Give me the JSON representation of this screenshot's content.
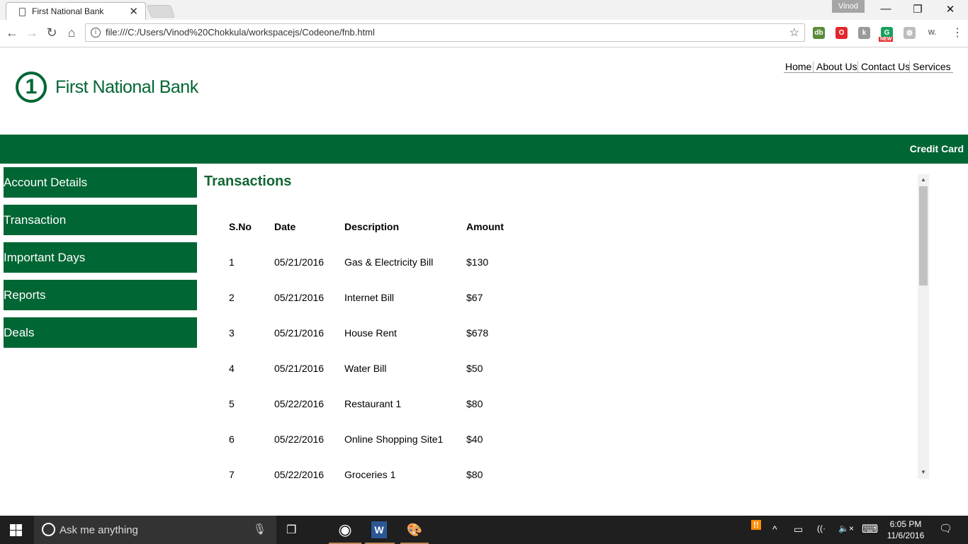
{
  "browser": {
    "tab_title": "First National Bank",
    "tab_close": "✕",
    "profile_name": "Vinod",
    "window_controls": {
      "minimize": "—",
      "restore": "❐",
      "close": "✕"
    },
    "nav": {
      "back": "←",
      "forward": "→",
      "reload": "↻",
      "home": "⌂"
    },
    "url": "file:///C:/Users/Vinod%20Chokkula/workspacejs/Codeone/fnb.html",
    "info_glyph": "i",
    "bookmark_glyph": "☆",
    "extensions": [
      {
        "name": "db-extension-icon",
        "label": "db",
        "color": "#5a8a3a"
      },
      {
        "name": "opera-extension-icon",
        "label": "O",
        "color": "#e0282c"
      },
      {
        "name": "k-extension-icon",
        "label": "k",
        "color": "#9a9a9a"
      },
      {
        "name": "grammarly-extension-icon",
        "label": "G",
        "color": "#18a05e"
      },
      {
        "name": "pin-extension-icon",
        "label": "◍",
        "color": "#bdbdbd"
      },
      {
        "name": "w-extension-icon",
        "label": "W.",
        "color": "#ffffff"
      }
    ],
    "ext_badge_new": "NEW",
    "menu_glyph": "⋮"
  },
  "page": {
    "logo_mark": "1",
    "logo_text": "First National Bank",
    "top_nav": [
      "Home",
      "About Us",
      "Contact Us",
      "Services"
    ],
    "banner_link": "Credit Card",
    "sidebar": [
      "Account Details",
      "Transaction",
      "Important Days",
      "Reports",
      "Deals"
    ],
    "content_title": "Transactions",
    "table": {
      "headers": [
        "S.No",
        "Date",
        "Description",
        "Amount"
      ],
      "rows": [
        [
          "1",
          "05/21/2016",
          "Gas & Electricity Bill",
          "$130"
        ],
        [
          "2",
          "05/21/2016",
          "Internet Bill",
          "$67"
        ],
        [
          "3",
          "05/21/2016",
          "House Rent",
          "$678"
        ],
        [
          "4",
          "05/21/2016",
          "Water Bill",
          "$50"
        ],
        [
          "5",
          "05/22/2016",
          "Restaurant 1",
          "$80"
        ],
        [
          "6",
          "05/22/2016",
          "Online Shopping Site1",
          "$40"
        ],
        [
          "7",
          "05/22/2016",
          "Groceries 1",
          "$80"
        ]
      ]
    },
    "scroll_up": "▲",
    "scroll_down": "▼"
  },
  "taskbar": {
    "search_placeholder": "Ask me anything",
    "mic_glyph": "🎙",
    "task_view_glyph": "❐",
    "apps": [
      {
        "name": "chrome-taskbar-icon",
        "label": "◉",
        "color": "#e0a020"
      },
      {
        "name": "word-taskbar-icon",
        "label": "W",
        "color": "#2b5797"
      },
      {
        "name": "paint-taskbar-icon",
        "label": "🎨",
        "color": "#d09040"
      }
    ],
    "tray_glyphs": {
      "alert": "!!",
      "chevron": "^",
      "battery": "▭",
      "wifi": "((·",
      "volume": "🔈×",
      "keyboard": "⌨",
      "notification": "🗨"
    },
    "time": "6:05 PM",
    "date": "11/6/2016"
  }
}
